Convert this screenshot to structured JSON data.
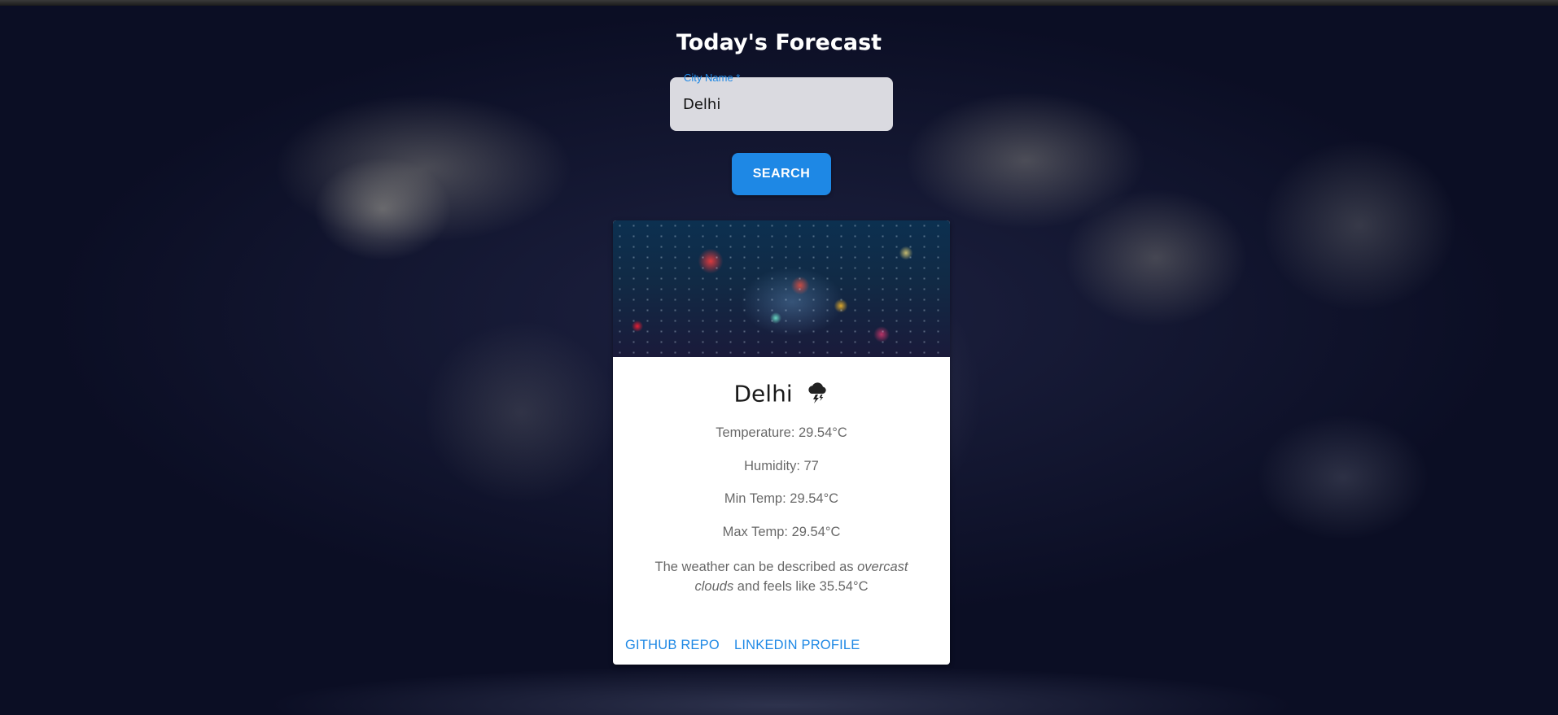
{
  "header": {
    "title": "Today's Forecast"
  },
  "search": {
    "label": "City Name *",
    "value": "Delhi",
    "button_label": "SEARCH"
  },
  "card": {
    "city": "Delhi",
    "weather_icon": "thunderstorm-cloud-icon",
    "temperature": "Temperature: 29.54°C",
    "humidity": "Humidity: 77",
    "min_temp": "Min Temp: 29.54°C",
    "max_temp": "Max Temp: 29.54°C",
    "desc_prefix": "The weather can be described as ",
    "desc_emphasis": "overcast clouds",
    "desc_suffix": " and feels like 35.54°C",
    "links": {
      "github": "GITHUB REPO",
      "linkedin": "LINKEDIN PROFILE"
    }
  },
  "colors": {
    "accent": "#1e88e5",
    "card": "#ffffff",
    "title": "#ffffff"
  }
}
